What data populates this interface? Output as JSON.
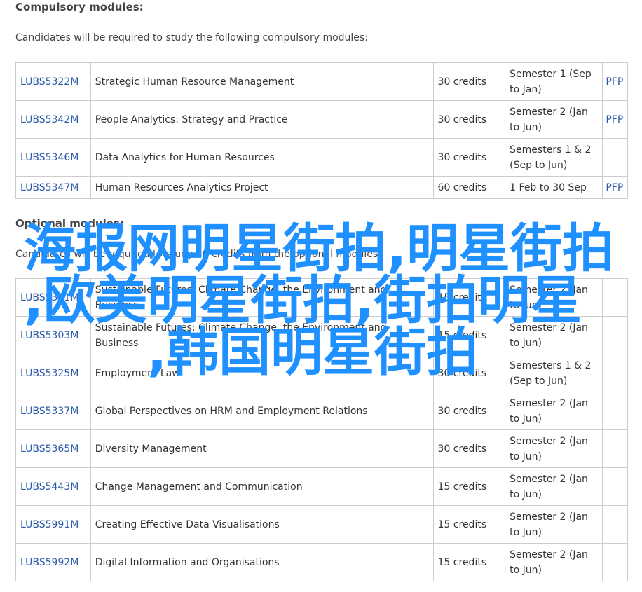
{
  "compulsory": {
    "title": "Compulsory modules:",
    "intro": "Candidates will be required to study the following compulsory modules:",
    "rows": [
      {
        "code": "LUBS5322M",
        "title": "Strategic Human Resource Management",
        "credits": "30 credits",
        "semester": "Semester 1 (Sep to Jan)",
        "pfp": "PFP"
      },
      {
        "code": "LUBS5342M",
        "title": "People Analytics: Strategy and Practice",
        "credits": "30 credits",
        "semester": "Semester 2 (Jan to Jun)",
        "pfp": "PFP"
      },
      {
        "code": "LUBS5346M",
        "title": "Data Analytics for Human Resources",
        "credits": "30 credits",
        "semester": "Semesters 1 & 2 (Sep to Jun)",
        "pfp": ""
      },
      {
        "code": "LUBS5347M",
        "title": "Human Resources Analytics Project",
        "credits": "60 credits",
        "semester": "1 Feb to 30 Sep",
        "pfp": "PFP"
      }
    ]
  },
  "optional": {
    "title": "Optional modules:",
    "intro": "Candidates will be required to study 30 credits from the optional modules:",
    "rows": [
      {
        "code": "LUBS5301M",
        "title": "Sustainable Futures: Climate Change, the Environment and Business",
        "credits": "15 credits",
        "semester": "Semester 2 (Jan to Jun)",
        "pfp": ""
      },
      {
        "code": "LUBS5303M",
        "title": "Sustainable Futures: Climate Change, the Environment and Business",
        "credits": "15 credits",
        "semester": "Semester 2 (Jan to Jun)",
        "pfp": ""
      },
      {
        "code": "LUBS5325M",
        "title": "Employment Law",
        "credits": "30 credits",
        "semester": "Semesters 1 & 2 (Sep to Jun)",
        "pfp": ""
      },
      {
        "code": "LUBS5337M",
        "title": "Global Perspectives on HRM and Employment Relations",
        "credits": "30 credits",
        "semester": "Semester 2 (Jan to Jun)",
        "pfp": ""
      },
      {
        "code": "LUBS5365M",
        "title": "Diversity Management",
        "credits": "30 credits",
        "semester": "Semester 2 (Jan to Jun)",
        "pfp": ""
      },
      {
        "code": "LUBS5443M",
        "title": "Change Management and Communication",
        "credits": "15 credits",
        "semester": "Semester 2 (Jan to Jun)",
        "pfp": ""
      },
      {
        "code": "LUBS5991M",
        "title": "Creating Effective Data Visualisations",
        "credits": "15 credits",
        "semester": "Semester 2 (Jan to Jun)",
        "pfp": ""
      },
      {
        "code": "LUBS5992M",
        "title": "Digital Information and Organisations",
        "credits": "15 credits",
        "semester": "Semester 2 (Jan to Jun)",
        "pfp": ""
      }
    ]
  },
  "watermark": {
    "line1": "海报网明星街拍,明星街拍",
    "line2": ",欧美明星街拍,街拍明星",
    "line3": ",韩国明星街拍"
  },
  "colors": {
    "link": "#2a5aa8",
    "watermark": "#1e90ff",
    "border": "#cccccc"
  }
}
